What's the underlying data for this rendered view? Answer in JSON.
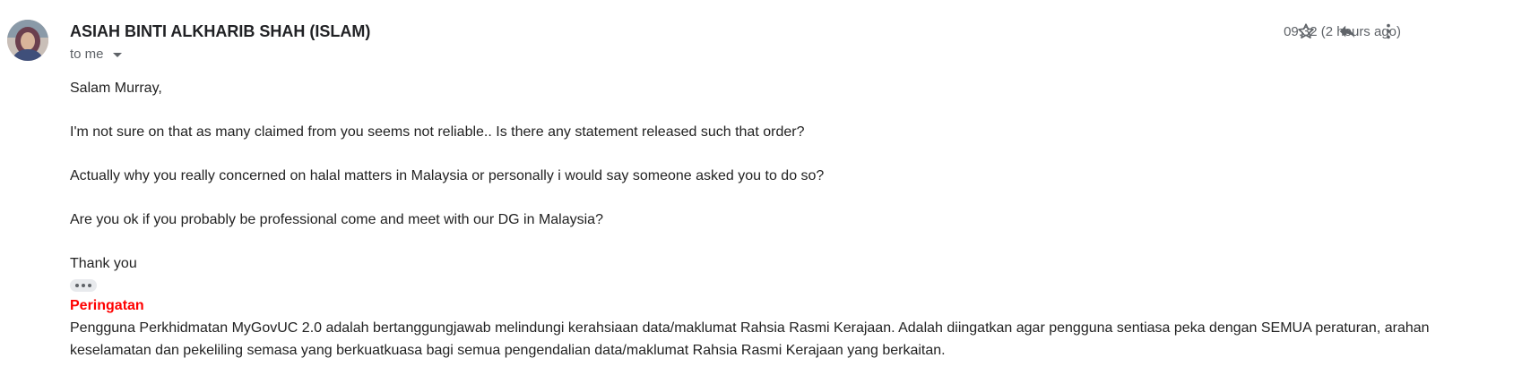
{
  "message": {
    "sender_name": "ASIAH BINTI ALKHARIB SHAH (ISLAM)",
    "recipient_label": "to me",
    "timestamp": "09:32 (2 hours ago)",
    "body": {
      "greeting": "Salam Murray,",
      "paragraphs": [
        "I'm not sure on that as many claimed from you seems not reliable.. Is there any statement released such that order?",
        "Actually why you really concerned on halal matters in Malaysia or personally i would say someone asked you to do so?",
        "Are you ok if you probably be professional come and meet with our DG in Malaysia?"
      ],
      "closing": "Thank you"
    },
    "signature": {
      "warning_title": "Peringatan",
      "warning_text": "Pengguna Perkhidmatan MyGovUC 2.0 adalah bertanggungjawab melindungi kerahsiaan data/maklumat Rahsia Rasmi Kerajaan. Adalah diingatkan agar pengguna sentiasa peka dengan SEMUA peraturan, arahan keselamatan dan pekeliling semasa yang berkuatkuasa bagi semua pengendalian data/maklumat Rahsia Rasmi Kerajaan yang berkaitan."
    }
  },
  "icons": {
    "star": "star-icon",
    "reply": "reply-icon",
    "more": "more-vert-icon",
    "expand": "trimmed-content-icon",
    "recipient_details": "chevron-down-icon"
  },
  "colors": {
    "warning_title": "#ff0000",
    "meta_text": "#5f6368",
    "icon": "#5f6368",
    "body_text": "#222222"
  }
}
